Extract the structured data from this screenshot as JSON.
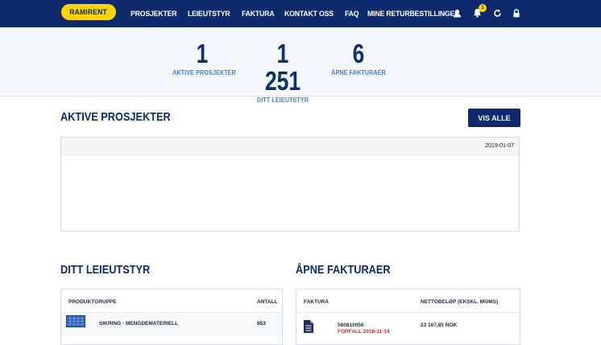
{
  "brand": {
    "logo_text": "RAMIRENT"
  },
  "nav": {
    "items": [
      "PROSJEKTER",
      "LEIEUTSTYR",
      "FAKTURA",
      "KONTAKT OSS",
      "FAQ",
      "MINE RETURBESTILLINGER"
    ]
  },
  "header_icons": {
    "user": "user-icon",
    "notifications": "bell-icon",
    "notification_count": "1",
    "refresh": "refresh-icon",
    "lock": "lock-icon"
  },
  "stats": [
    {
      "value": "1",
      "label": "AKTIVE PROSJEKTER"
    },
    {
      "value": "1 251",
      "label": "DITT LEIEUTSTYR"
    },
    {
      "value": "6",
      "label": "ÅPNE FAKTURAER"
    }
  ],
  "active_projects": {
    "title": "AKTIVE PROSJEKTER",
    "view_all": "VIS ALLE",
    "date": "2019-01-07"
  },
  "equipment": {
    "title": "DITT LEIEUTSTYR",
    "columns": [
      "PRODUKTGRUPPE",
      "ANTALL"
    ],
    "rows": [
      {
        "group": "SIKRING - MENGDEMATERIELL",
        "count": "853"
      }
    ]
  },
  "invoices": {
    "title": "ÅPNE FAKTURAER",
    "columns": [
      "FAKTURA",
      "NETTOBELØP (EKSKL. MOMS)"
    ],
    "rows": [
      {
        "number": "580810056",
        "due": "FORFALL 2018-11-14",
        "amount": "23 167,85 NOK"
      }
    ]
  },
  "colors": {
    "primary": "#0c2a6c",
    "accent": "#ffd400",
    "due": "#d21f26",
    "stat_label": "#4a7ec2"
  }
}
